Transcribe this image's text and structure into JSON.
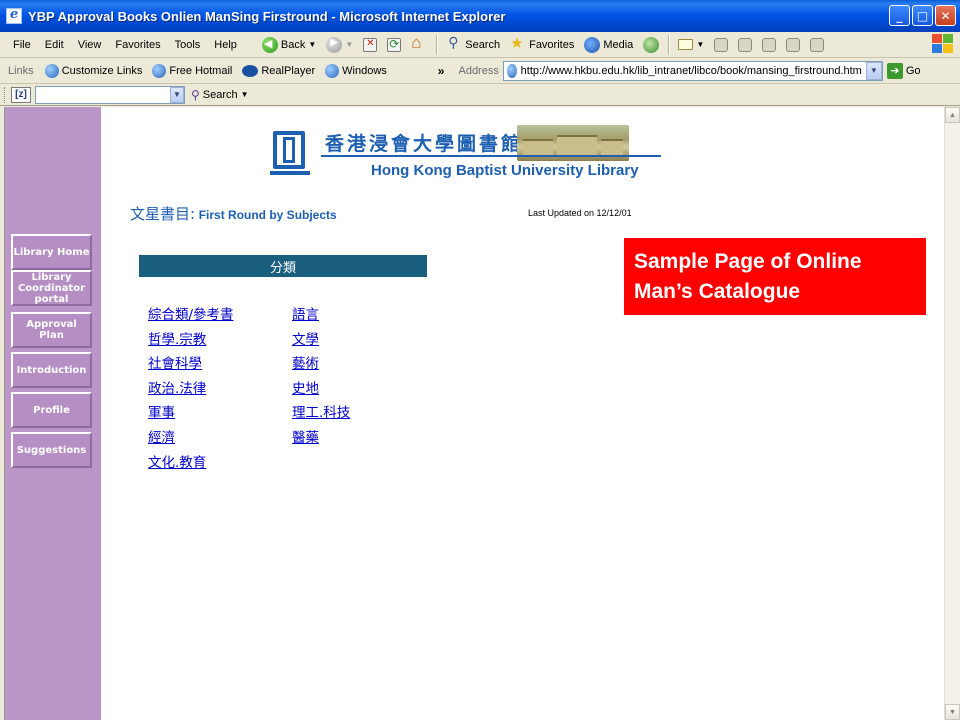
{
  "window": {
    "title": "YBP Approval Books Onlien ManSing Firstround - Microsoft Internet Explorer"
  },
  "menu": [
    "File",
    "Edit",
    "View",
    "Favorites",
    "Tools",
    "Help"
  ],
  "toolbar": {
    "back": "Back",
    "search": "Search",
    "favorites": "Favorites",
    "media": "Media"
  },
  "links": {
    "label": "Links",
    "items": [
      "Customize Links",
      "Free Hotmail",
      "RealPlayer",
      "Windows"
    ],
    "more": "»"
  },
  "address": {
    "label": "Address",
    "url": "http://www.hkbu.edu.hk/lib_intranet/libco/book/mansing_firstround.htm",
    "go": "Go"
  },
  "searchbar": {
    "search_label": "Search"
  },
  "nav": {
    "items": [
      "Library Home",
      "Library Coordinator portal",
      "Approval Plan",
      "Introduction",
      "Profile",
      "Suggestions"
    ]
  },
  "logo": {
    "chinese": "香港浸會大學圖書館",
    "english": "Hong Kong Baptist University Library"
  },
  "page": {
    "title_cn": "文星書目:",
    "title_en": "First Round by Subjects",
    "updated": "Last Updated on 12/12/01",
    "category_header": "分類"
  },
  "categories": {
    "left": [
      "綜合類/參考書",
      "哲學.宗教",
      "社會科學",
      "政治.法律",
      "軍事",
      "經濟",
      "文化.教育"
    ],
    "right": [
      "語言",
      "文學",
      "藝術",
      "史地",
      "理工.科技",
      "醫藥"
    ]
  },
  "callout": {
    "line1": "Sample Page of Online",
    "line2": "Man’s Catalogue"
  },
  "colors": {
    "nav_purple": "#bb96c8",
    "header_teal": "#1a5e7e",
    "library_blue": "#1d5fb0",
    "callout_red": "#ff0000"
  }
}
